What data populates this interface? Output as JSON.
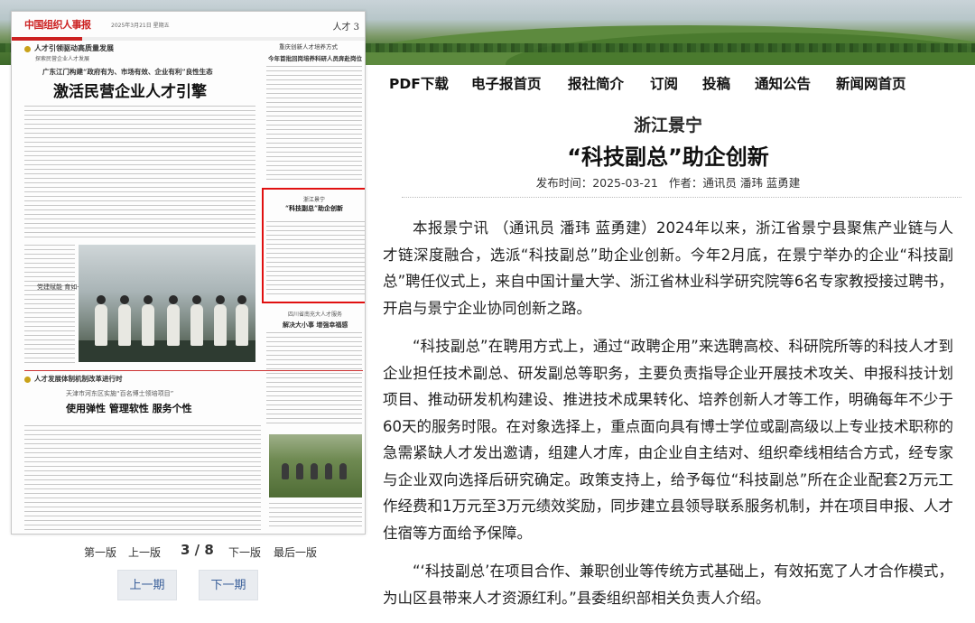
{
  "newspaper_page": {
    "masthead": "中国组织人事报",
    "date_line": "2025年3月21日 星期五",
    "section": "人才 3",
    "top_kicker": "人才引领驱动高质量发展",
    "top_sub": "探索民营企业人才发展",
    "main_kicker": "广东江门构建“政府有为、市场有效、企业有利”良性生态",
    "main_headline": "激活民营企业人才引擎",
    "right_kicker": "重庆创新人才培养方式",
    "right_headline": "今年首批回岗培养科研人员奔赴岗位",
    "highlight_kicker": "浙江景宁",
    "highlight_title": "“科技副总”助企创新",
    "mid_kicker": "四川省南充大人才服务",
    "mid_headline": "解决大小事 增强幸福感",
    "bottom_section": "人才发展体制机制改革进行时",
    "bottom_kicker": "天津市河东区实施“百名博士领培项目”",
    "bottom_headline": "使用弹性 管理软性 服务个性",
    "photo_caption": "党建赋能 育如一"
  },
  "pager": {
    "first": "第一版",
    "prev": "上一版",
    "current": "3 / 8",
    "next": "下一版",
    "last": "最后一版",
    "prev_issue": "上一期",
    "next_issue": "下一期"
  },
  "nav": [
    "PDF下载",
    "电子报首页",
    "报社简介",
    "订阅",
    "投稿",
    "通知公告",
    "新闻网首页"
  ],
  "article": {
    "kicker": "浙江景宁",
    "title": "“科技副总”助企创新",
    "publish_label": "发布时间：",
    "publish_date": "2025-03-21",
    "author_label": "作者：",
    "author": "通讯员 潘玮 蓝勇建",
    "paragraphs": [
      "本报景宁讯 （通讯员 潘玮 蓝勇建）2024年以来，浙江省景宁县聚焦产业链与人才链深度融合，选派“科技副总”助企业创新。今年2月底，在景宁举办的企业“科技副总”聘任仪式上，来自中国计量大学、浙江省林业科学研究院等6名专家教授接过聘书，开启与景宁企业协同创新之路。",
      "“科技副总”在聘用方式上，通过“政聘企用”来选聘高校、科研院所等的科技人才到企业担任技术副总、研发副总等职务，主要负责指导企业开展技术攻关、申报科技计划项目、推动研发机构建设、推进技术成果转化、培养创新人才等工作，明确每年不少于60天的服务时限。在对象选择上，重点面向具有博士学位或副高级以上专业技术职称的急需紧缺人才发出邀请，组建人才库，由企业自主结对、组织牵线相结合方式，经专家与企业双向选择后研究确定。政策支持上，给予每位“科技副总”所在企业配套2万元工作经费和1万元至3万元绩效奖励，同步建立县领导联系服务机制，并在项目申报、人才住宿等方面给予保障。",
      "“‘科技副总’在项目合作、兼职创业等传统方式基础上，有效拓宽了人才合作模式，为山区县带来人才资源红利。”县委组织部相关负责人介绍。"
    ]
  }
}
